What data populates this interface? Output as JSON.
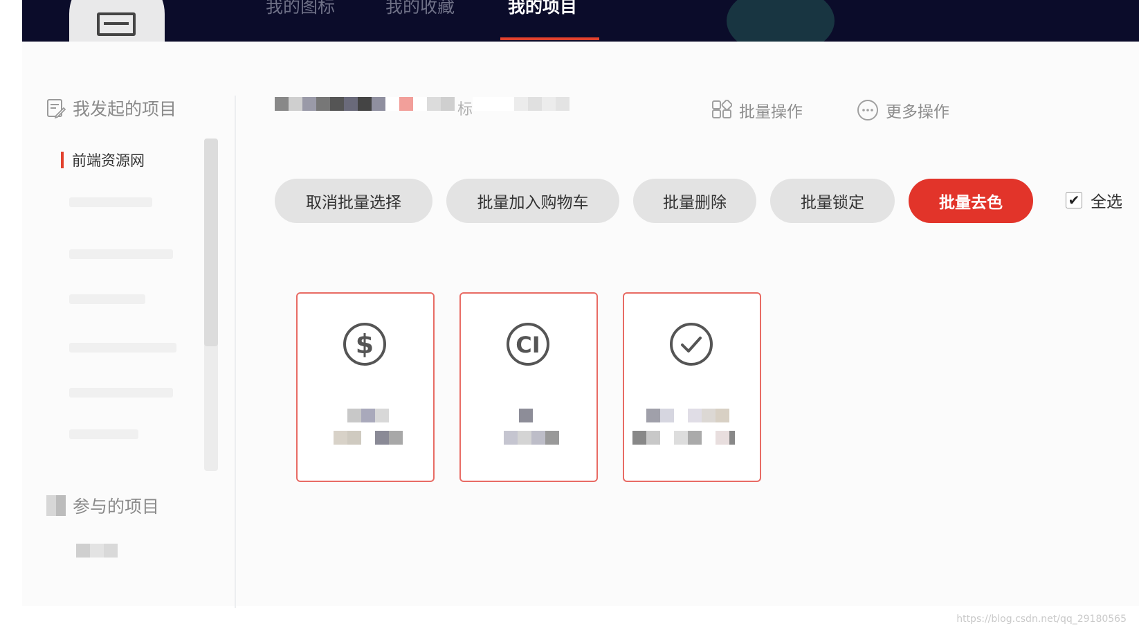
{
  "nav": {
    "tabs": [
      {
        "label": "我的图标",
        "active": false
      },
      {
        "label": "我的收藏",
        "active": false
      },
      {
        "label": "我的项目",
        "active": true
      }
    ]
  },
  "sidebar": {
    "my_projects_title": "我发起的项目",
    "active_project": "前端资源网",
    "joined_projects_title": "参与的项目"
  },
  "toolbar": {
    "title_suffix": "标",
    "batch_ops": "批量操作",
    "more_ops": "更多操作"
  },
  "actions": {
    "cancel_select": "取消批量选择",
    "add_to_cart": "批量加入购物车",
    "delete": "批量删除",
    "lock": "批量锁定",
    "decolor": "批量去色",
    "select_all": "全选",
    "select_all_checked": true
  },
  "cards": [
    {
      "icon": "dollar-circle-icon"
    },
    {
      "icon": "ci-circle-icon"
    },
    {
      "icon": "check-circle-icon"
    }
  ],
  "colors": {
    "nav_bg": "#0b0c2a",
    "accent": "#e2342a",
    "card_border": "#e86b64"
  },
  "watermark": "https://blog.csdn.net/qq_29180565"
}
